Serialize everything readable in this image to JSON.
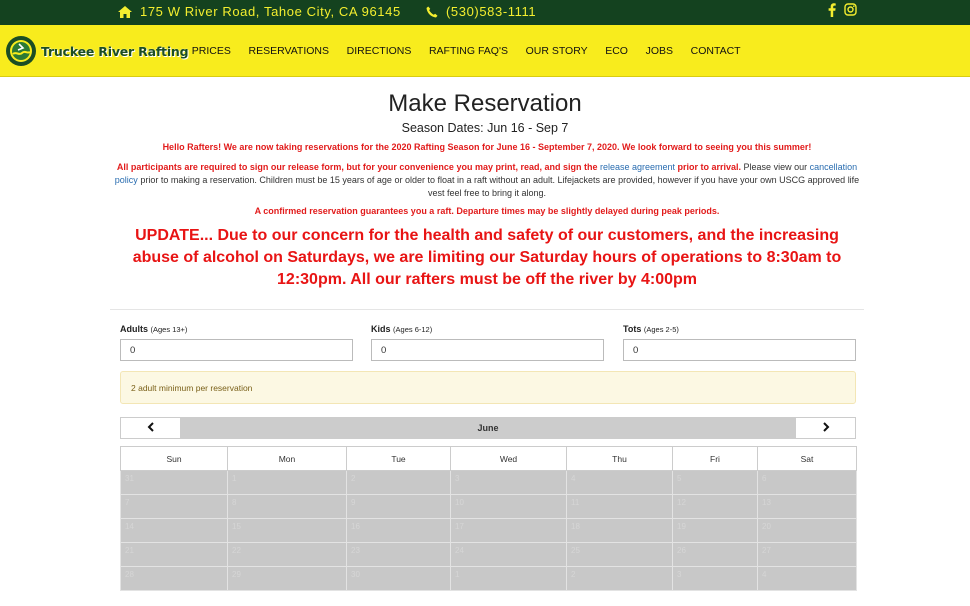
{
  "topbar": {
    "address": "175 W River Road, Tahoe City, CA 96145",
    "phone": "(530)583-1111",
    "icons": [
      "home-icon",
      "phone-icon",
      "facebook-icon",
      "instagram-icon"
    ],
    "color": "#14421f",
    "text_color": "#f4ee2f"
  },
  "nav": {
    "logo_text": "Truckee River Rafting",
    "color": "#f8ec1d",
    "items": [
      "PRICES",
      "RESERVATIONS",
      "DIRECTIONS",
      "RAFTING FAQ'S",
      "OUR STORY",
      "ECO",
      "JOBS",
      "CONTACT"
    ]
  },
  "page": {
    "title": "Make Reservation",
    "season": "Season Dates: Jun 16 - Sep 7",
    "notice1": "Hello Rafters! We are now taking reservations for the 2020 Rafting Season for June 16 - September 7, 2020. We look forward to seeing you this summer!",
    "notice2_red_a": "All participants are required to sign our release form, but for your convenience you may print, read, and sign the ",
    "notice2_link1": "release agreement",
    "notice2_red_b": " prior to arrival.",
    "notice2_text_a": " Please view our ",
    "notice2_link2": "cancellation policy",
    "notice2_text_b": " prior to making a reservation. Children must be 15 years of age or older to float in a raft without an adult. Lifejackets are provided, however if you have your own USCG approved life vest feel free to bring it along.",
    "notice3": "A confirmed reservation guarantees you a raft. Departure times may be slightly delayed during peak periods.",
    "update": "UPDATE... Due to our concern for the health and safety of our customers, and the increasing abuse of alcohol on Saturdays, we are limiting our Saturday hours of operations to 8:30am to 12:30pm. All our rafters must be off the river by 4:00pm",
    "accent": "#e21b1b"
  },
  "form": {
    "adults": {
      "label": "Adults",
      "sub": "(Ages 13+)",
      "value": "0"
    },
    "kids": {
      "label": "Kids",
      "sub": "(Ages 6-12)",
      "value": "0"
    },
    "tots": {
      "label": "Tots",
      "sub": "(Ages 2-5)",
      "value": "0"
    },
    "alert": "2 adult minimum per reservation"
  },
  "calendar": {
    "month": "June",
    "prev_icon": "chevron-left-icon",
    "next_icon": "chevron-right-icon",
    "weekdays": [
      "Sun",
      "Mon",
      "Tue",
      "Wed",
      "Thu",
      "Fri",
      "Sat"
    ],
    "weeks": [
      [
        "31",
        "1",
        "2",
        "3",
        "4",
        "5",
        "6"
      ],
      [
        "7",
        "8",
        "9",
        "10",
        "11",
        "12",
        "13"
      ],
      [
        "14",
        "15",
        "16",
        "17",
        "18",
        "19",
        "20"
      ],
      [
        "21",
        "22",
        "23",
        "24",
        "25",
        "26",
        "27"
      ],
      [
        "28",
        "29",
        "30",
        "1",
        "2",
        "3",
        "4"
      ]
    ]
  }
}
